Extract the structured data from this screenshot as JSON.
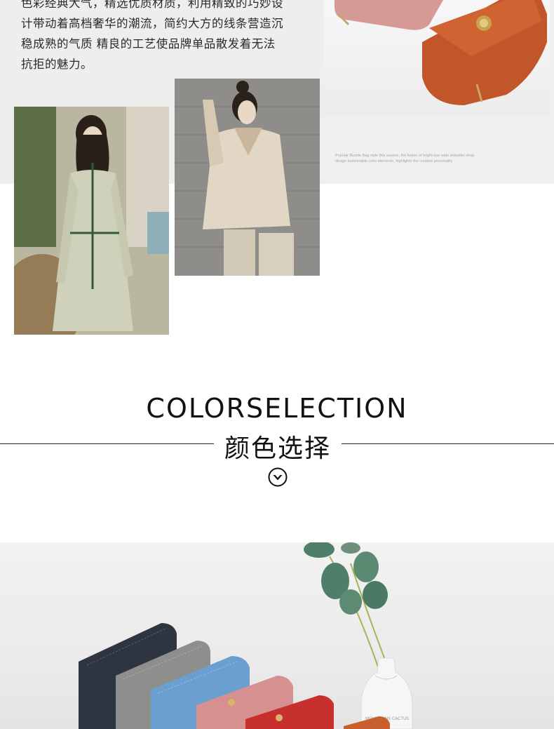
{
  "intro": {
    "lines": [
      "色彩经典大气，精选优质材质，利用精致的巧妙设",
      "计带动着高档奢华的潮流，简约大方的线条营造沉",
      "稳成熟的气质 精良的工艺使品牌单品散发着无法",
      "抗拒的魅力。"
    ]
  },
  "caption": {
    "lines": [
      "Popular Buckle Bag style this season, the fusion of bright eye wide shoulder strap",
      "design fashionable color elements, highlights the creative personality"
    ]
  },
  "color_selection": {
    "title": "COLORSELECTION",
    "subtitle": "颜色选择",
    "icon": "chevron-down-circle-icon"
  },
  "bottom_photo": {
    "vase_text": "MOUNTAINS CACTUS",
    "wallet_colors": [
      "#2f3540",
      "#8e8e8c",
      "#6b9fd0",
      "#d6908f",
      "#c8302e",
      "#c8602e"
    ]
  },
  "colors": {
    "text": "#2a2a2a",
    "rule": "#222222",
    "leaf": "#4f7f68"
  }
}
